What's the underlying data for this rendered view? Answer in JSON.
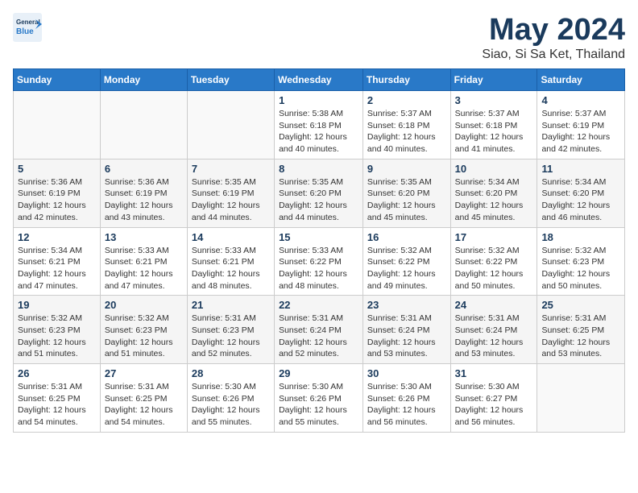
{
  "header": {
    "logo_line1": "General",
    "logo_line2": "Blue",
    "title": "May 2024",
    "subtitle": "Siao, Si Sa Ket, Thailand"
  },
  "weekdays": [
    "Sunday",
    "Monday",
    "Tuesday",
    "Wednesday",
    "Thursday",
    "Friday",
    "Saturday"
  ],
  "weeks": [
    [
      {
        "day": "",
        "info": ""
      },
      {
        "day": "",
        "info": ""
      },
      {
        "day": "",
        "info": ""
      },
      {
        "day": "1",
        "info": "Sunrise: 5:38 AM\nSunset: 6:18 PM\nDaylight: 12 hours\nand 40 minutes."
      },
      {
        "day": "2",
        "info": "Sunrise: 5:37 AM\nSunset: 6:18 PM\nDaylight: 12 hours\nand 40 minutes."
      },
      {
        "day": "3",
        "info": "Sunrise: 5:37 AM\nSunset: 6:18 PM\nDaylight: 12 hours\nand 41 minutes."
      },
      {
        "day": "4",
        "info": "Sunrise: 5:37 AM\nSunset: 6:19 PM\nDaylight: 12 hours\nand 42 minutes."
      }
    ],
    [
      {
        "day": "5",
        "info": "Sunrise: 5:36 AM\nSunset: 6:19 PM\nDaylight: 12 hours\nand 42 minutes."
      },
      {
        "day": "6",
        "info": "Sunrise: 5:36 AM\nSunset: 6:19 PM\nDaylight: 12 hours\nand 43 minutes."
      },
      {
        "day": "7",
        "info": "Sunrise: 5:35 AM\nSunset: 6:19 PM\nDaylight: 12 hours\nand 44 minutes."
      },
      {
        "day": "8",
        "info": "Sunrise: 5:35 AM\nSunset: 6:20 PM\nDaylight: 12 hours\nand 44 minutes."
      },
      {
        "day": "9",
        "info": "Sunrise: 5:35 AM\nSunset: 6:20 PM\nDaylight: 12 hours\nand 45 minutes."
      },
      {
        "day": "10",
        "info": "Sunrise: 5:34 AM\nSunset: 6:20 PM\nDaylight: 12 hours\nand 45 minutes."
      },
      {
        "day": "11",
        "info": "Sunrise: 5:34 AM\nSunset: 6:20 PM\nDaylight: 12 hours\nand 46 minutes."
      }
    ],
    [
      {
        "day": "12",
        "info": "Sunrise: 5:34 AM\nSunset: 6:21 PM\nDaylight: 12 hours\nand 47 minutes."
      },
      {
        "day": "13",
        "info": "Sunrise: 5:33 AM\nSunset: 6:21 PM\nDaylight: 12 hours\nand 47 minutes."
      },
      {
        "day": "14",
        "info": "Sunrise: 5:33 AM\nSunset: 6:21 PM\nDaylight: 12 hours\nand 48 minutes."
      },
      {
        "day": "15",
        "info": "Sunrise: 5:33 AM\nSunset: 6:22 PM\nDaylight: 12 hours\nand 48 minutes."
      },
      {
        "day": "16",
        "info": "Sunrise: 5:32 AM\nSunset: 6:22 PM\nDaylight: 12 hours\nand 49 minutes."
      },
      {
        "day": "17",
        "info": "Sunrise: 5:32 AM\nSunset: 6:22 PM\nDaylight: 12 hours\nand 50 minutes."
      },
      {
        "day": "18",
        "info": "Sunrise: 5:32 AM\nSunset: 6:23 PM\nDaylight: 12 hours\nand 50 minutes."
      }
    ],
    [
      {
        "day": "19",
        "info": "Sunrise: 5:32 AM\nSunset: 6:23 PM\nDaylight: 12 hours\nand 51 minutes."
      },
      {
        "day": "20",
        "info": "Sunrise: 5:32 AM\nSunset: 6:23 PM\nDaylight: 12 hours\nand 51 minutes."
      },
      {
        "day": "21",
        "info": "Sunrise: 5:31 AM\nSunset: 6:23 PM\nDaylight: 12 hours\nand 52 minutes."
      },
      {
        "day": "22",
        "info": "Sunrise: 5:31 AM\nSunset: 6:24 PM\nDaylight: 12 hours\nand 52 minutes."
      },
      {
        "day": "23",
        "info": "Sunrise: 5:31 AM\nSunset: 6:24 PM\nDaylight: 12 hours\nand 53 minutes."
      },
      {
        "day": "24",
        "info": "Sunrise: 5:31 AM\nSunset: 6:24 PM\nDaylight: 12 hours\nand 53 minutes."
      },
      {
        "day": "25",
        "info": "Sunrise: 5:31 AM\nSunset: 6:25 PM\nDaylight: 12 hours\nand 53 minutes."
      }
    ],
    [
      {
        "day": "26",
        "info": "Sunrise: 5:31 AM\nSunset: 6:25 PM\nDaylight: 12 hours\nand 54 minutes."
      },
      {
        "day": "27",
        "info": "Sunrise: 5:31 AM\nSunset: 6:25 PM\nDaylight: 12 hours\nand 54 minutes."
      },
      {
        "day": "28",
        "info": "Sunrise: 5:30 AM\nSunset: 6:26 PM\nDaylight: 12 hours\nand 55 minutes."
      },
      {
        "day": "29",
        "info": "Sunrise: 5:30 AM\nSunset: 6:26 PM\nDaylight: 12 hours\nand 55 minutes."
      },
      {
        "day": "30",
        "info": "Sunrise: 5:30 AM\nSunset: 6:26 PM\nDaylight: 12 hours\nand 56 minutes."
      },
      {
        "day": "31",
        "info": "Sunrise: 5:30 AM\nSunset: 6:27 PM\nDaylight: 12 hours\nand 56 minutes."
      },
      {
        "day": "",
        "info": ""
      }
    ]
  ]
}
